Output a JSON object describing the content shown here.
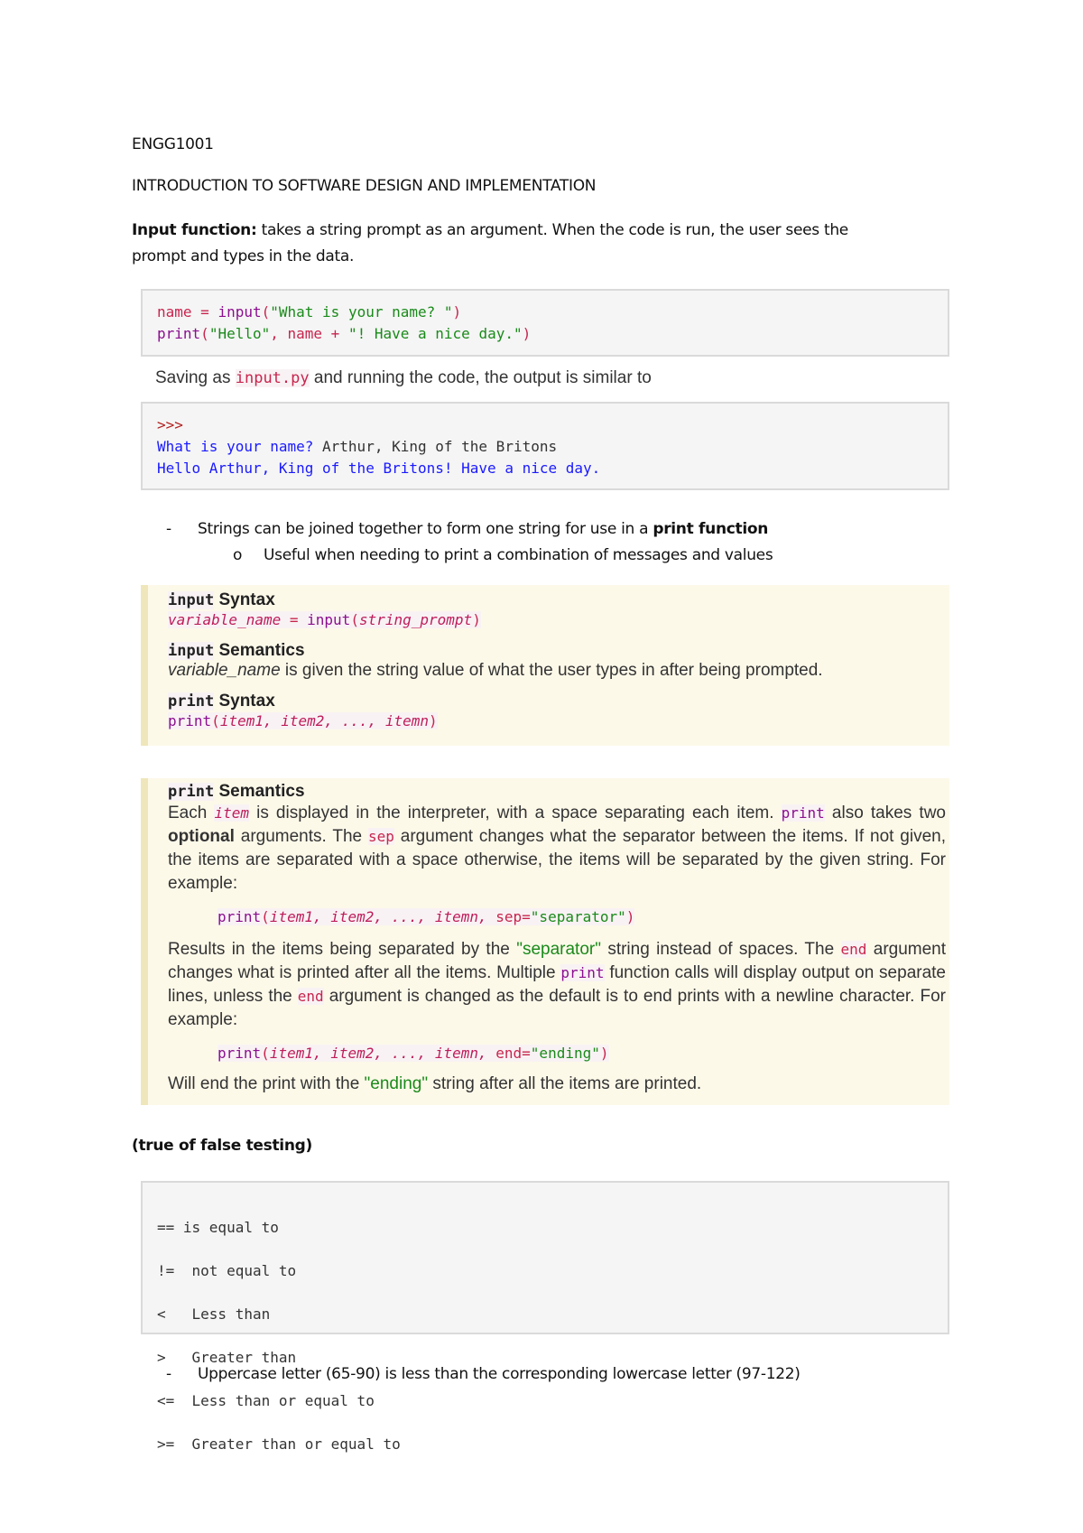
{
  "header": {
    "course": "ENGG1001",
    "title": "INTRODUCTION TO SOFTWARE DESIGN AND IMPLEMENTATION"
  },
  "intro": {
    "label": "Input function:",
    "text": " takes a string prompt as an argument. When the code is run, the user sees the",
    "text2": "prompt and types in the data."
  },
  "code1": {
    "l1": [
      "name",
      " = ",
      "input",
      "(",
      "\"What is your name? \"",
      ")"
    ],
    "l2": [
      "print",
      "(",
      "\"Hello\"",
      ", ",
      "name",
      " + ",
      "\"! Have a nice day.\"",
      ")"
    ]
  },
  "saving": {
    "pre": "Saving as ",
    "file": "input.py",
    "post": " and running the code, the output is similar to"
  },
  "output": {
    "prompt": ">>>",
    "l1a": "What is your name?",
    "l1b": " Arthur, King of the Britons",
    "l2": "Hello Arthur, King of the Britons! Have a nice day."
  },
  "bullets": {
    "b1_dash": "-",
    "b1": "Strings can be joined together to form one string for use in a ",
    "b1_bold": "print function",
    "b2_marker": "o",
    "b2": "Useful when needing to print a combination of messages and values"
  },
  "note1": {
    "h1_code": "input",
    "h1": " Syntax",
    "s1_var": "variable_name",
    "s1_eq": " = ",
    "s1_fn": "input",
    "s1_p1": "(",
    "s1_arg": "string_prompt",
    "s1_p2": ")",
    "h2_code": "input",
    "h2": " Semantics",
    "t2_it": "variable_name",
    "t2": " is given the string value of what the user types in after being prompted.",
    "h3_code": "print",
    "h3": " Syntax",
    "s3_fn": "print",
    "s3_p1": "(",
    "s3_args": "item1, item2, ..., itemn",
    "s3_p2": ")"
  },
  "note2": {
    "h_code": "print",
    "h": " Semantics",
    "p1a": "Each ",
    "p1b": "item",
    "p1c": " is displayed in the interpreter, with a space separating each item. ",
    "p1d": "print",
    "p1e": " also takes two ",
    "p1f": "optional",
    "p1g": " arguments. The ",
    "p1h": "sep",
    "p1i": " argument changes what the separator between the items. If not given, the items are separated with a space otherwise, the items will be separated by the given string. For example:",
    "ex1_fn": "print",
    "ex1_p": "(",
    "ex1_args": "item1, item2, ..., itemn, ",
    "ex1_kw": "sep=",
    "ex1_str": "\"separator\"",
    "ex1_end": ")",
    "p2a": "Results in the items being separated by the ",
    "p2b": "\"separator\"",
    "p2c": " string instead of spaces. The ",
    "p2d": "end",
    "p2e": " argument changes what is printed after all the items. Multiple ",
    "p2f": "print",
    "p2g": " function calls will display output on separate lines, unless the ",
    "p2h": "end",
    "p2i": " argument is changed as the default is to end prints with a newline character. For example:",
    "ex2_fn": "print",
    "ex2_p": "(",
    "ex2_args": "item1, item2, ..., itemn, ",
    "ex2_kw": "end=",
    "ex2_str": "\"ending\"",
    "ex2_end": ")",
    "p3a": "Will end the print with the ",
    "p3b": "\"ending\"",
    "p3c": " string after all the items are printed."
  },
  "tf": {
    "heading": "(true of false testing)",
    "rows": [
      "== is equal to",
      "!=  not equal to",
      "<   Less than",
      ">   Greater than",
      "<=  Less than or equal to",
      ">=  Greater than or equal to"
    ]
  },
  "last": {
    "dash": "-",
    "text": "Uppercase letter (65-90) is less than the corresponding lowercase letter (97-122)"
  }
}
